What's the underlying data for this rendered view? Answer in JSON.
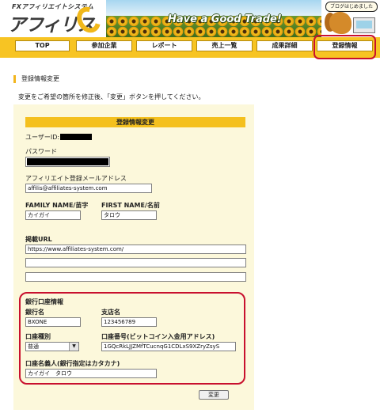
{
  "header": {
    "logo_small": "FXアフィリエイトシステム",
    "logo_big": "アフィリス",
    "banner_text": "Have a Good Trade!",
    "blog_badge": "ブログはじめました"
  },
  "nav": {
    "items": [
      {
        "label": "TOP"
      },
      {
        "label": "参加企業"
      },
      {
        "label": "レポート"
      },
      {
        "label": "売上一覧"
      },
      {
        "label": "成果詳細"
      },
      {
        "label": "登録情報"
      }
    ],
    "active": "登録情報",
    "highlight_color": "#c8102e"
  },
  "page": {
    "title": "登録情報変更",
    "intro": "変更をご希望の箇所を修正後、「変更」ボタンを押してください。"
  },
  "form": {
    "header": "登録情報変更",
    "user_id_label": "ユーザーID:",
    "password_label": "パスワード",
    "email_label": "アフィリエイト登録メールアドレス",
    "email_value": "affilis@affiliates-system.com",
    "family_name_label": "FAMILY NAME/苗字",
    "family_name_value": "カイガイ",
    "first_name_label": "FIRST NAME/名前",
    "first_name_value": "タロウ",
    "url_label": "掲載URL",
    "url_values": [
      "https://www.affiliates-system.com/",
      "",
      ""
    ],
    "bank_section_label": "銀行口座情報",
    "bank_name_label": "銀行名",
    "bank_name_value": "BXONE",
    "branch_label": "支店名",
    "branch_value": "123456789",
    "account_type_label": "口座種別",
    "account_type_value": "普通",
    "account_number_label": "口座番号(ビットコイン入金用アドレス)",
    "account_number_value": "1GQcRkLJJZMfTCucnqG1CDLxS9XZryZsyS",
    "holder_label": "口座名義人(銀行指定はカタカナ)",
    "holder_value": "カイガイ　タロウ",
    "submit_label": "変更"
  },
  "colors": {
    "nav_bar": "#f7c423",
    "panel_bg": "#fcf8db",
    "panel_header": "#f4c01e",
    "highlight": "#c8102e"
  }
}
